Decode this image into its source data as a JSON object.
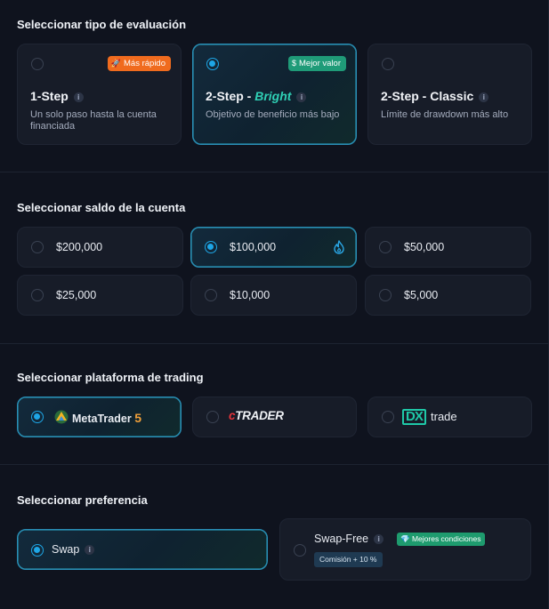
{
  "evaluation": {
    "title": "Seleccionar tipo de evaluación",
    "options": [
      {
        "name": "1-Step",
        "name_suffix": "",
        "desc": "Un solo paso hasta la cuenta financiada",
        "badge": "Más rápido",
        "selected": false
      },
      {
        "name": "2-Step - ",
        "name_suffix": "Bright",
        "desc": "Objetivo de beneficio más bajo",
        "badge": "Mejor valor",
        "selected": true
      },
      {
        "name": "2-Step - Classic",
        "name_suffix": "",
        "desc": "Límite de drawdown más alto",
        "badge": "",
        "selected": false
      }
    ]
  },
  "balance": {
    "title": "Seleccionar saldo de la cuenta",
    "options": [
      {
        "amount": "$200,000",
        "selected": false
      },
      {
        "amount": "$100,000",
        "selected": true
      },
      {
        "amount": "$50,000",
        "selected": false
      },
      {
        "amount": "$25,000",
        "selected": false
      },
      {
        "amount": "$10,000",
        "selected": false
      },
      {
        "amount": "$5,000",
        "selected": false
      }
    ]
  },
  "platform": {
    "title": "Seleccionar plataforma de trading",
    "options": [
      {
        "name": "MetaTrader",
        "name_suffix": "5",
        "selected": true
      },
      {
        "name_prefix": "c",
        "name": "TRADER",
        "selected": false
      },
      {
        "name_prefix": "DX",
        "name": "trade",
        "selected": false
      }
    ]
  },
  "preference": {
    "title": "Seleccionar preferencia",
    "options": [
      {
        "label": "Swap",
        "selected": true
      },
      {
        "label": "Swap-Free",
        "badge": "Mejores condiciones",
        "commission": "Comisión + 10 %",
        "selected": false
      }
    ]
  },
  "colors": {
    "accent": "#1ea6e6",
    "badge_orange": "#f06b1e",
    "badge_green": "#1f9b78",
    "bright_text": "#2fd0b5"
  }
}
